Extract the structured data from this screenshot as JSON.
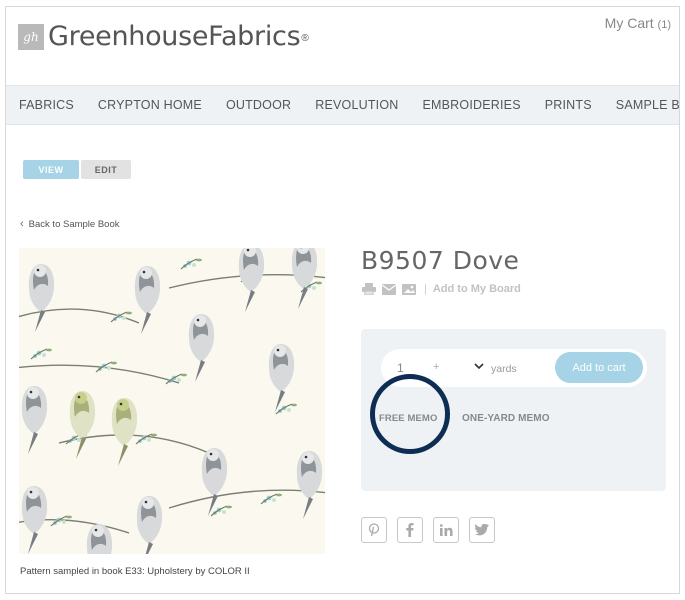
{
  "header": {
    "logo_mark": "gh",
    "logo_text": "GreenhouseFabrics",
    "logo_reg": "®",
    "cart_label": "My Cart",
    "cart_count": "(1)"
  },
  "nav": [
    "FABRICS",
    "CRYPTON HOME",
    "OUTDOOR",
    "REVOLUTION",
    "EMBROIDERIES",
    "PRINTS",
    "SAMPLE BOOKS"
  ],
  "toggle": {
    "view": "VIEW",
    "edit": "EDIT"
  },
  "back_link": "Back to Sample Book",
  "product": {
    "title": "B9507 Dove",
    "add_to_board": "Add to My Board",
    "quantity": "1",
    "plus": "+",
    "unit": "yards",
    "add_to_cart": "Add to cart",
    "free_memo": "FREE MEMO",
    "one_yard_memo": "ONE-YARD MEMO"
  },
  "caption": "Pattern sampled in book E33: Upholstery by COLOR II",
  "social": [
    "pinterest-icon",
    "facebook-icon",
    "linkedin-icon",
    "twitter-icon"
  ],
  "colors": {
    "accent": "#a6d3e5",
    "annotation_circle": "#0e2d52",
    "nav_bg": "#eef2f5"
  }
}
